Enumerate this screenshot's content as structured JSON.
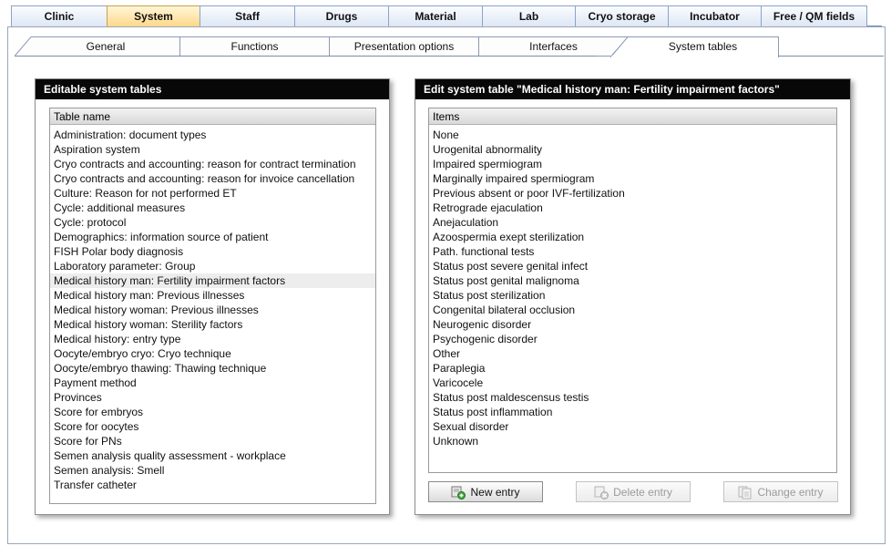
{
  "main_tabs": [
    {
      "label": "Clinic",
      "active": false
    },
    {
      "label": "System",
      "active": true
    },
    {
      "label": "Staff",
      "active": false
    },
    {
      "label": "Drugs",
      "active": false
    },
    {
      "label": "Material",
      "active": false
    },
    {
      "label": "Lab",
      "active": false
    },
    {
      "label": "Cryo storage",
      "active": false
    },
    {
      "label": "Incubator",
      "active": false
    },
    {
      "label": "Free / QM fields",
      "active": false
    }
  ],
  "sub_tabs": [
    {
      "label": "General",
      "active": false
    },
    {
      "label": "Functions",
      "active": false
    },
    {
      "label": "Presentation options",
      "active": false
    },
    {
      "label": "Interfaces",
      "active": false
    },
    {
      "label": "System tables",
      "active": true
    }
  ],
  "left_panel": {
    "title": "Editable system tables",
    "column_header": "Table name",
    "selected_index": 10,
    "items": [
      "Administration: document types",
      "Aspiration system",
      "Cryo contracts and accounting: reason for contract termination",
      "Cryo contracts and accounting: reason for invoice cancellation",
      "Culture: Reason for not performed ET",
      "Cycle: additional measures",
      "Cycle: protocol",
      "Demographics: information source of patient",
      "FISH Polar body diagnosis",
      "Laboratory parameter: Group",
      "Medical history man: Fertility impairment factors",
      "Medical history man: Previous illnesses",
      "Medical history woman: Previous illnesses",
      "Medical history woman: Sterility factors",
      "Medical history: entry type",
      "Oocyte/embryo cryo: Cryo technique",
      "Oocyte/embryo thawing: Thawing technique",
      "Payment method",
      "Provinces",
      "Score for embryos",
      "Score for oocytes",
      "Score for PNs",
      "Semen analysis quality assessment - workplace",
      "Semen analysis: Smell",
      "Transfer catheter"
    ]
  },
  "right_panel": {
    "title": "Edit system table \"Medical history man: Fertility impairment factors\"",
    "column_header": "Items",
    "items": [
      "None",
      "Urogenital abnormality",
      "Impaired spermiogram",
      "Marginally impaired spermiogram",
      "Previous absent or poor IVF-fertilization",
      "Retrograde ejaculation",
      "Anejaculation",
      "Azoospermia exept sterilization",
      "Path. functional tests",
      "Status post severe genital infect",
      "Status post genital malignoma",
      "Status post sterilization",
      "Congenital bilateral occlusion",
      "Neurogenic disorder",
      "Psychogenic disorder",
      "Other",
      "Paraplegia",
      "Varicocele",
      "Status post maldescensus testis",
      "Status post inflammation",
      "Sexual disorder",
      "Unknown"
    ],
    "buttons": {
      "new": "New entry",
      "delete": "Delete entry",
      "change": "Change entry"
    }
  },
  "icons": {
    "new": "add-document-icon",
    "delete": "delete-document-icon",
    "change": "edit-document-icon"
  },
  "colors": {
    "active_tab": "#ffd88a",
    "panel_header": "#080808",
    "selected_row": "#ededed"
  }
}
